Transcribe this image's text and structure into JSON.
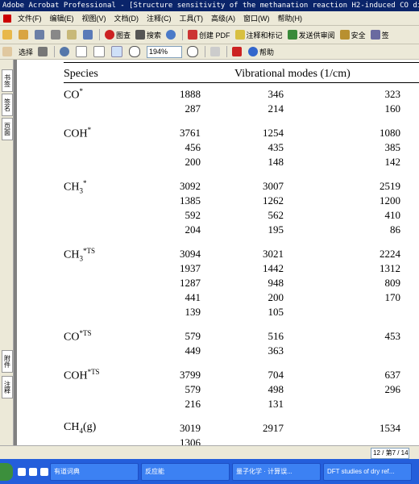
{
  "window": {
    "title": "Adobe Acrobat Professional - [Structure sensitivity of the methanation reaction H2-induced CO dis"
  },
  "menu": [
    "文件(F)",
    "编辑(E)",
    "视图(V)",
    "文档(D)",
    "注释(C)",
    "工具(T)",
    "高级(A)",
    "窗口(W)",
    "帮助(H)"
  ],
  "toolbar1": {
    "labels": [
      "图查",
      "搜索",
      "创建 PDF",
      "注释和标记",
      "发送供审阅",
      "安全",
      "签"
    ]
  },
  "toolbar2": {
    "select_label": "选择",
    "zoom_value": "194%",
    "help_label": "帮助"
  },
  "left_panel": {
    "tabs": [
      "书签",
      "签名",
      "页面",
      "附件",
      "注释"
    ]
  },
  "table": {
    "header": {
      "species": "Species",
      "modes": "Vibrational modes (1/cm)"
    },
    "rows": [
      {
        "species": "CO*",
        "base": "CO",
        "sup": "*",
        "sub": "",
        "values": [
          [
            "1888",
            "346",
            "323"
          ],
          [
            "287",
            "214",
            "160"
          ]
        ]
      },
      {
        "species": "COH*",
        "base": "COH",
        "sup": "*",
        "sub": "",
        "values": [
          [
            "3761",
            "1254",
            "1080"
          ],
          [
            "456",
            "435",
            "385"
          ],
          [
            "200",
            "148",
            "142"
          ]
        ]
      },
      {
        "species": "CH3*",
        "base": "CH",
        "sup": "*",
        "sub": "3",
        "values": [
          [
            "3092",
            "3007",
            "2519"
          ],
          [
            "1385",
            "1262",
            "1200"
          ],
          [
            "592",
            "562",
            "410"
          ],
          [
            "204",
            "195",
            "86"
          ]
        ]
      },
      {
        "species": "CH3*TS",
        "base": "CH",
        "sup": "*TS",
        "sub": "3",
        "values": [
          [
            "3094",
            "3021",
            "2224"
          ],
          [
            "1937",
            "1442",
            "1312"
          ],
          [
            "1287",
            "948",
            "809"
          ],
          [
            "441",
            "200",
            "170"
          ],
          [
            "139",
            "105",
            ""
          ]
        ]
      },
      {
        "species": "CO*TS",
        "base": "CO",
        "sup": "*TS",
        "sub": "",
        "values": [
          [
            "579",
            "516",
            "453"
          ],
          [
            "449",
            "363",
            ""
          ]
        ]
      },
      {
        "species": "COH*TS",
        "base": "COH",
        "sup": "*TS",
        "sub": "",
        "values": [
          [
            "3799",
            "704",
            "637"
          ],
          [
            "579",
            "498",
            "296"
          ],
          [
            "216",
            "131",
            ""
          ]
        ]
      },
      {
        "species": "CH4(g)",
        "base": "CH",
        "sup": "",
        "sub": "4",
        "tail": "(g)",
        "values": [
          [
            "3019",
            "2917",
            "1534"
          ],
          [
            "1306",
            "",
            ""
          ]
        ]
      }
    ]
  },
  "status": {
    "page_indicator": "12 / 第7 / 14 页"
  },
  "taskbar": {
    "tasks": [
      "有道词典",
      "反应能",
      "量子化学 · 计算误...",
      "DFT studies of dry ref..."
    ]
  }
}
